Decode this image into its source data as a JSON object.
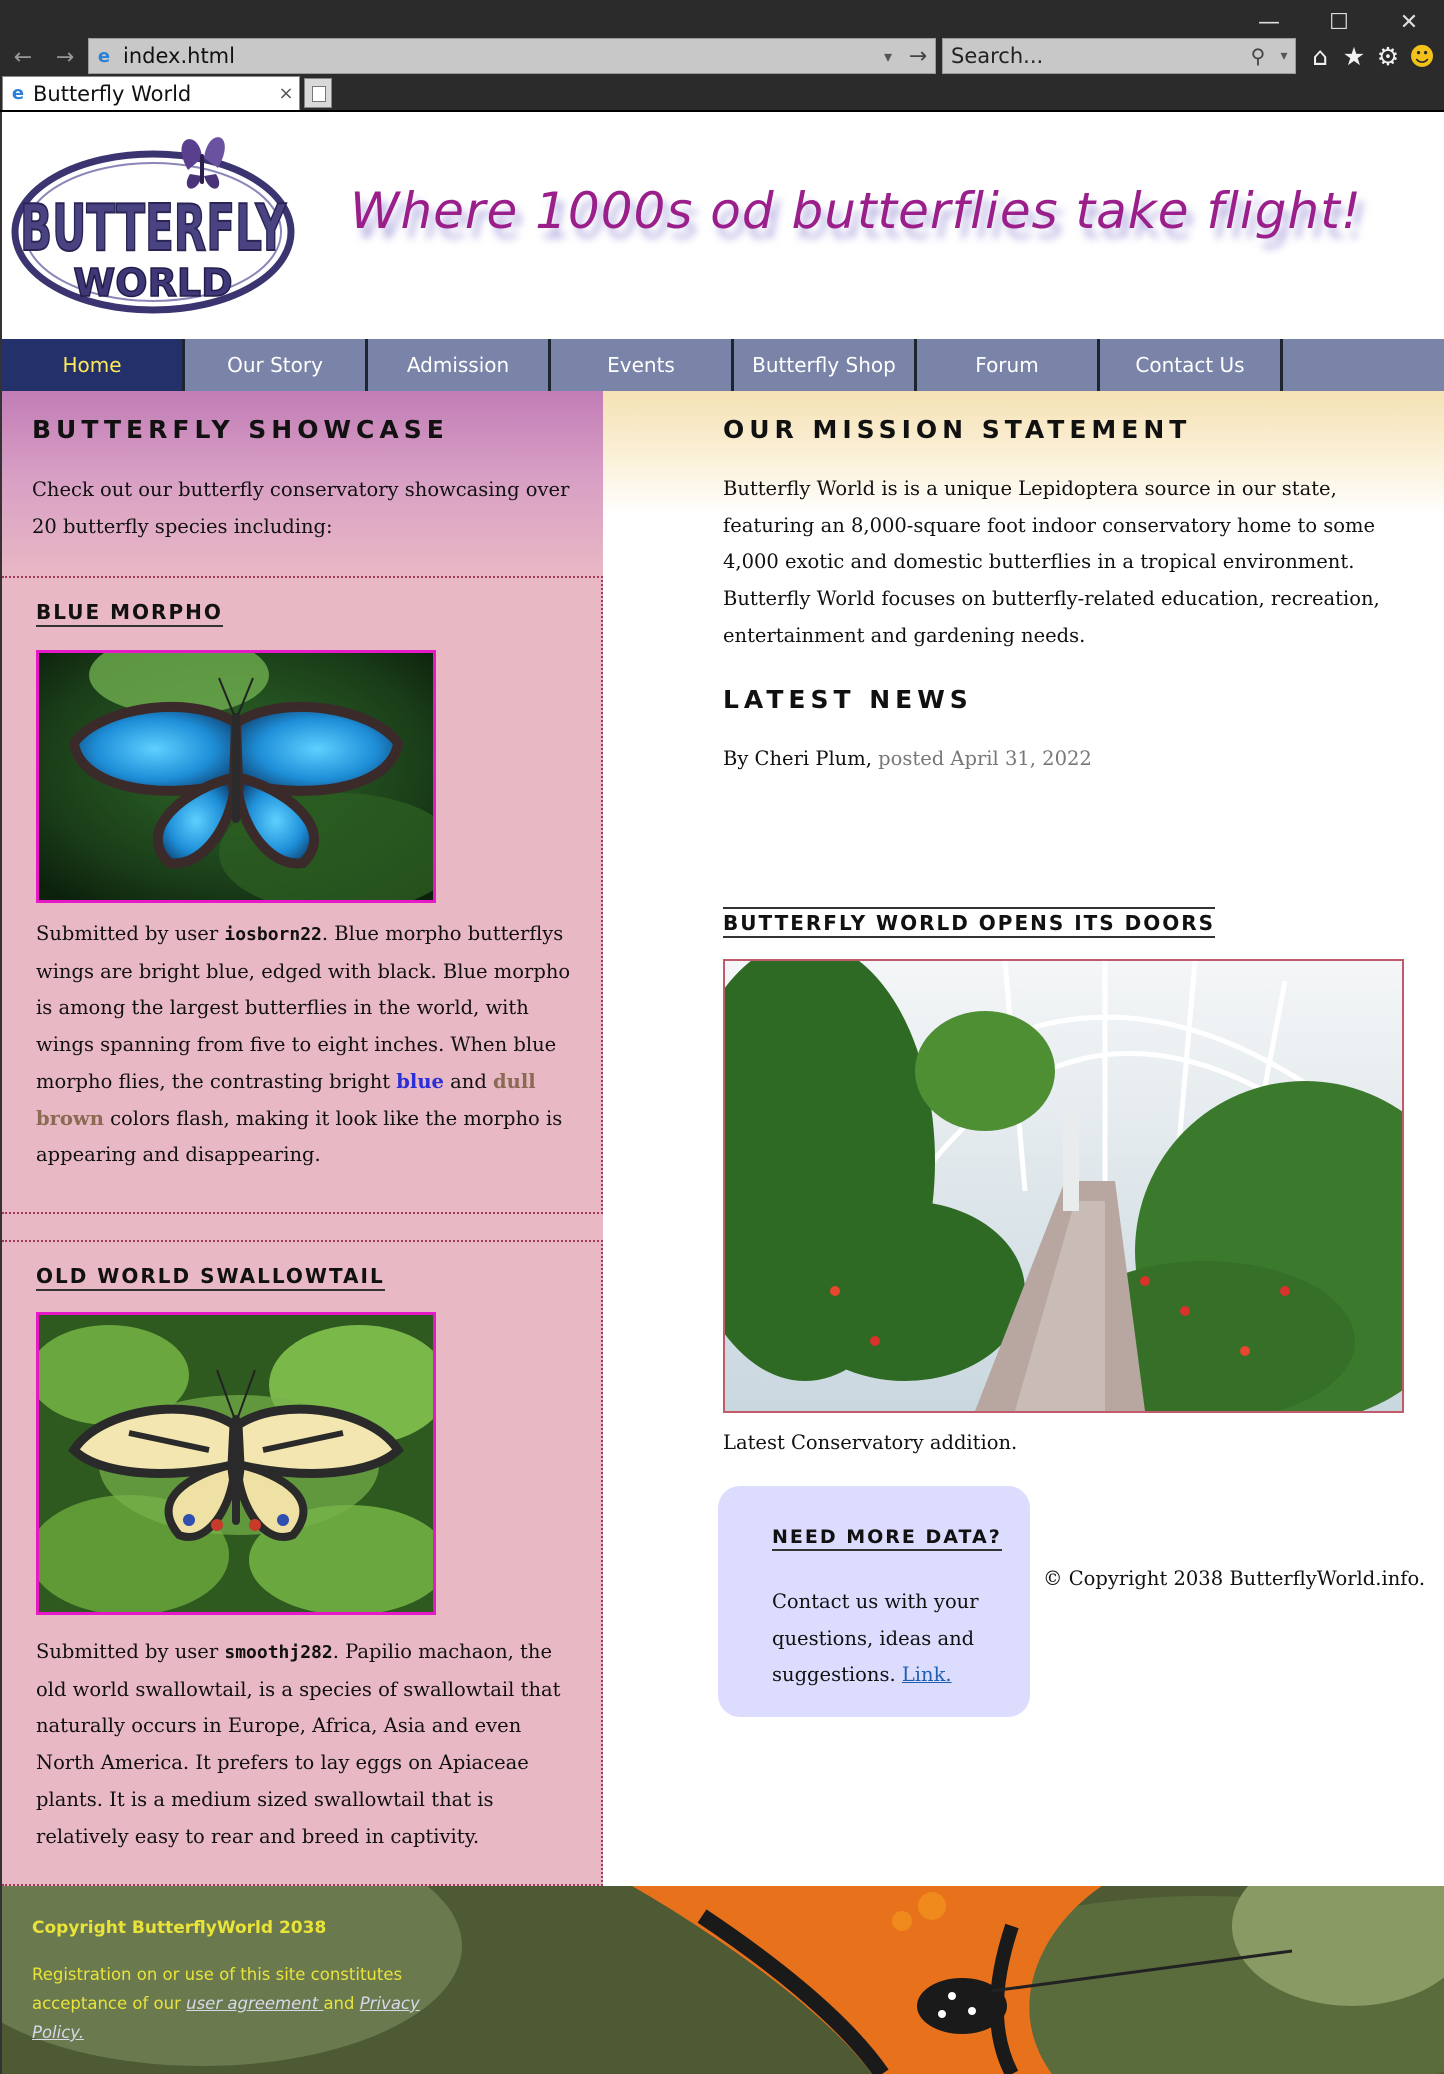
{
  "browser": {
    "address": "index.html",
    "search_placeholder": "Search...",
    "tab_title": "Butterfly World",
    "minimize": "—",
    "maximize": "☐",
    "close": "✕",
    "back": "←",
    "forward": "→",
    "go": "→",
    "dropdown": "▾",
    "search_icon": "⚲",
    "tab_close": "×",
    "icons": [
      "home-icon",
      "star-icon",
      "gear-icon",
      "smiley-icon"
    ]
  },
  "header": {
    "logo_alt": "BUTTERFLY WORLD",
    "tagline": "Where 1000s od butterflies take flight!"
  },
  "nav": {
    "items": [
      "Home",
      "Our Story",
      "Admission",
      "Events",
      "Butterfly Shop",
      "Forum",
      "Contact Us"
    ],
    "active": "Home"
  },
  "showcase": {
    "heading": "BUTTERFLY SHOWCASE",
    "intro": "Check out our butterfly conservatory showcasing over 20 butterfly species including:",
    "cards": [
      {
        "heading": "BLUE MORPHO",
        "prefix": "Submitted by user ",
        "user": "iosborn22",
        "text_a": ". Blue morpho butterflys wings are bright blue, edged with black. Blue morpho is among the largest butterflies in the world, with wings spanning from five to eight inches. When blue morpho flies, the contrasting bright ",
        "word_blue": "blue",
        "text_b": " and ",
        "word_brown": "dull brown",
        "text_c": " colors flash, making it look like the morpho is appearing and disappearing."
      },
      {
        "heading": "OLD WORLD SWALLOWTAIL",
        "prefix": "Submitted by user ",
        "user": "smoothj282",
        "text": ". Papilio machaon, the old world swallowtail, is a species of swallowtail that naturally occurs in Europe, Africa, Asia and even North America. It prefers to lay eggs on Apiaceae plants. It is a medium sized swallowtail that is relatively easy to rear and breed in captivity."
      }
    ]
  },
  "mission": {
    "heading": "OUR MISSION STATEMENT",
    "text": "Butterfly World is is a unique Lepidoptera source in our state, featuring an 8,000-square foot indoor conservatory home to some 4,000 exotic and domestic butterflies in a tropical environment. Butterfly World focuses on butterfly-related education, recreation, entertainment and gardening needs."
  },
  "news": {
    "heading": "LATEST NEWS",
    "author": "By Cheri Plum, ",
    "date": "posted April 31, 2022",
    "article_heading": "BUTTERFLY WORLD OPENS ITS DOORS",
    "caption": "Latest Conservatory addition."
  },
  "data_card": {
    "heading": "NEED MORE DATA?",
    "text": "Contact us with your questions, ideas and suggestions. ",
    "link": "Link."
  },
  "copyright_inline": "© Copyright 2038 ButterflyWorld.info.",
  "footer": {
    "copyright": "Copyright ButterflyWorld 2038",
    "reg_a": "Registration on or use of this site constitutes acceptance of our ",
    "user_agreement": "user agreement ",
    "reg_b": "and ",
    "privacy": "Privacy Policy."
  },
  "colors": {
    "nav_bg": "#7a84a8",
    "nav_active": "#23306a",
    "tagline": "#9a1f8a",
    "showcase_bg": "#e9b8c5",
    "card_border": "#e619c8",
    "data_card_bg": "#dcdcff",
    "footer_text": "#e9e33a"
  }
}
